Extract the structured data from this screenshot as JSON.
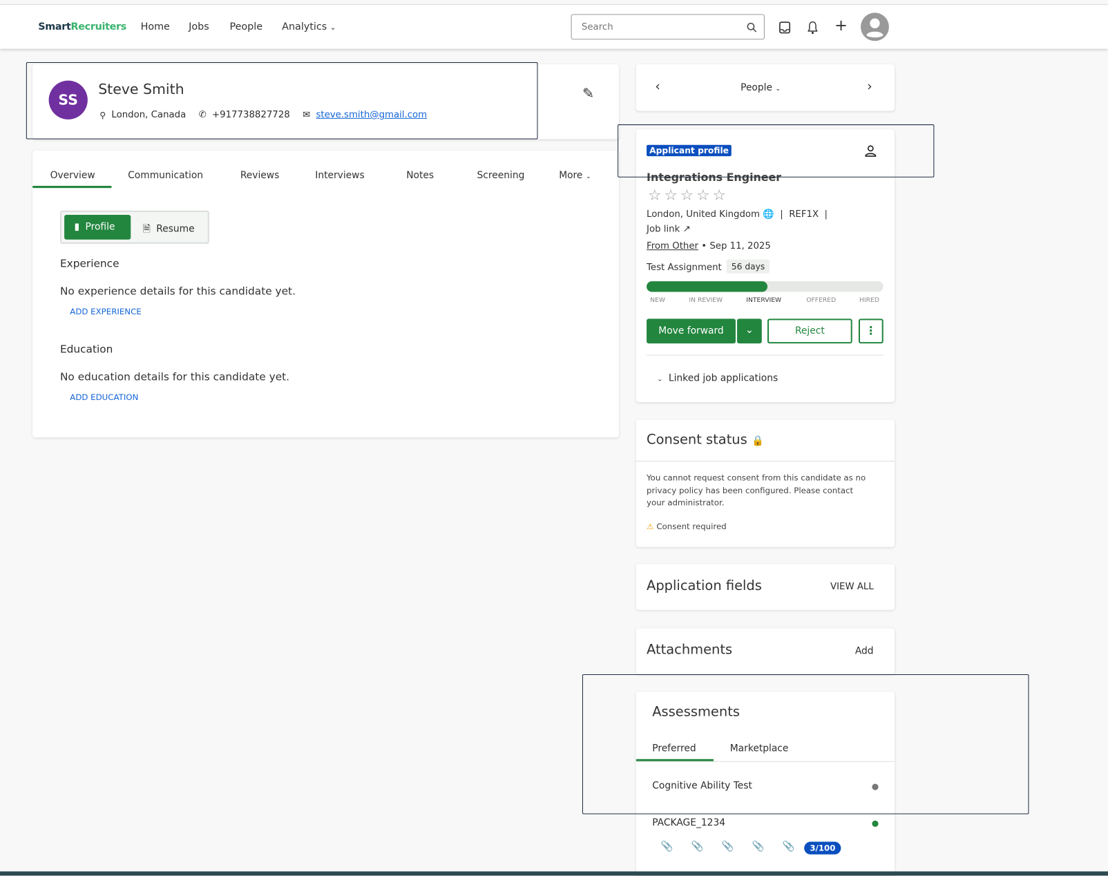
{
  "nav": {
    "logo_part1": "Smart",
    "logo_part2": "Recruiters",
    "links": [
      "Home",
      "Jobs",
      "People",
      "Analytics"
    ],
    "search_placeholder": "Search"
  },
  "candidate": {
    "initials": "SS",
    "name": "Steve Smith",
    "location": "London, Canada",
    "phone": "+917738827728",
    "email": "steve.smith@gmail.com"
  },
  "tabs": [
    "Overview",
    "Communication",
    "Reviews",
    "Interviews",
    "Notes",
    "Screening",
    "More"
  ],
  "toggle": {
    "profile": "Profile",
    "resume": "Resume"
  },
  "experience": {
    "title": "Experience",
    "empty": "No experience details for this candidate yet.",
    "add": "ADD EXPERIENCE"
  },
  "education": {
    "title": "Education",
    "empty": "No education details for this candidate yet.",
    "add": "ADD EDUCATION"
  },
  "pager": {
    "label": "People"
  },
  "application": {
    "badge": "Applicant profile",
    "job_title": "Integrations Engineer",
    "rating": 0,
    "rating_max": 5,
    "location": "London, United Kingdom",
    "ref": "REF1X",
    "job_link": "Job link",
    "source": "From Other",
    "sep": "•",
    "date": "Sep 11, 2025",
    "step": "Test Assignment",
    "days": "56 days",
    "progress_percent": 51,
    "stages": [
      "NEW",
      "IN REVIEW",
      "INTERVIEW",
      "OFFERED",
      "HIRED"
    ],
    "current_stage": "INTERVIEW",
    "move_forward": "Move forward",
    "reject": "Reject",
    "linked": "Linked job applications"
  },
  "consent": {
    "title": "Consent status",
    "message": "You cannot request consent from this candidate as no privacy policy has been configured. Please contact your administrator.",
    "status": "Consent required"
  },
  "app_fields": {
    "title": "Application fields",
    "action": "VIEW ALL"
  },
  "attachments": {
    "title": "Attachments",
    "action": "Add"
  },
  "assessments": {
    "title": "Assessments",
    "tabs": [
      "Preferred",
      "Marketplace"
    ],
    "items": [
      {
        "name": "Cognitive Ability Test",
        "status_color": "#777777"
      },
      {
        "name": "PACKAGE_1234",
        "status_color": "#23863f"
      }
    ],
    "count_badge": "3/100"
  },
  "colors": {
    "brand_green": "#23863f",
    "link_blue": "#1565d8",
    "badge_blue": "#0b4fbf",
    "avatar_purple": "#7030a0"
  }
}
